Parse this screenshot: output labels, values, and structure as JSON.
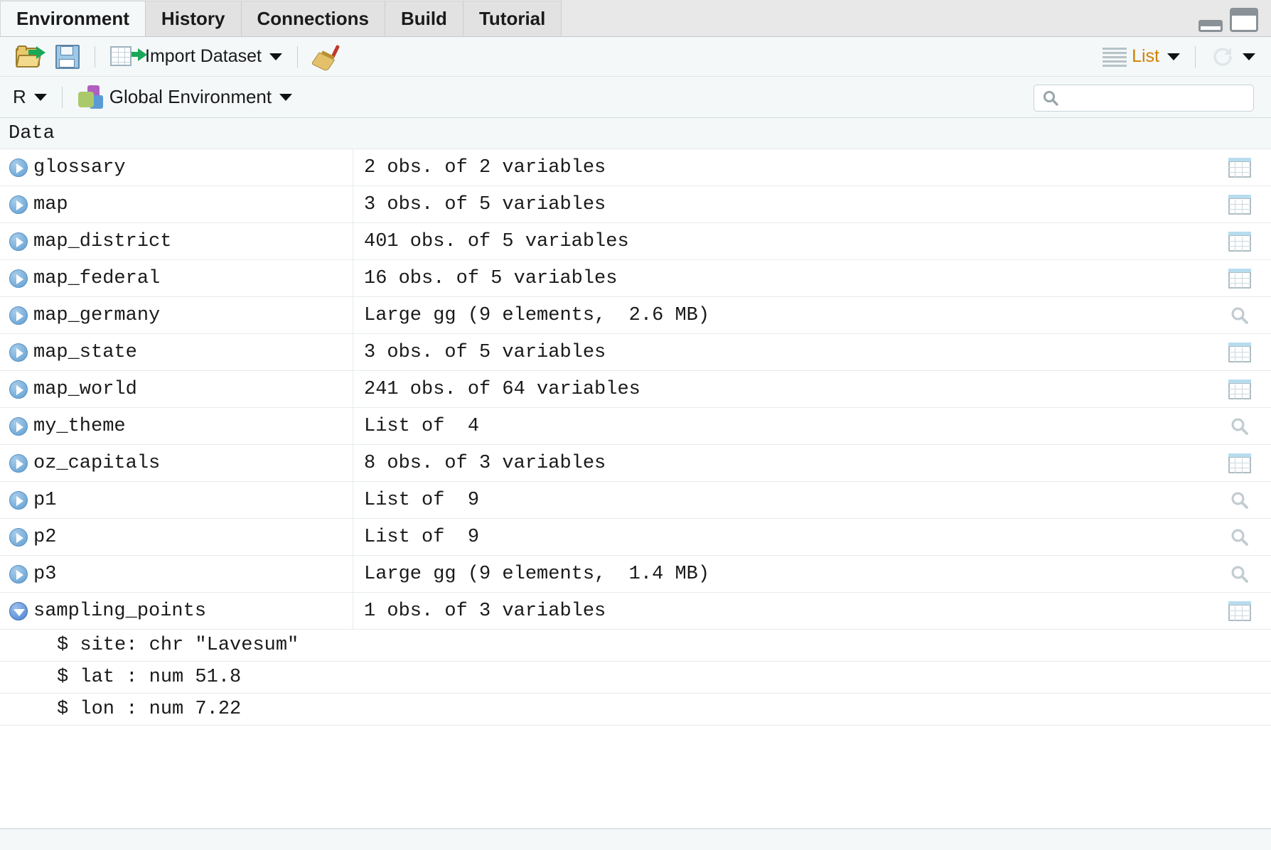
{
  "window": {
    "tabs": [
      {
        "label": "Environment",
        "active": true
      },
      {
        "label": "History",
        "active": false
      },
      {
        "label": "Connections",
        "active": false
      },
      {
        "label": "Build",
        "active": false
      },
      {
        "label": "Tutorial",
        "active": false
      }
    ],
    "minimize_icon": "minimize-icon",
    "maximize_icon": "maximize-icon"
  },
  "toolbar": {
    "load_workspace_icon": "open-folder-icon",
    "save_workspace_icon": "save-disk-icon",
    "import_dataset_label": "Import Dataset",
    "import_dataset_icon": "import-grid-icon",
    "clear_objects_icon": "broom-icon",
    "view_mode_label": "List",
    "view_mode_icon": "list-view-icon",
    "refresh_icon": "refresh-icon"
  },
  "envbar": {
    "language_label": "R",
    "environment_label": "Global Environment",
    "environment_icon": "cubes-icon",
    "search_placeholder": "",
    "search_value": "",
    "search_icon": "search-icon"
  },
  "table": {
    "group_header": "Data",
    "rows": [
      {
        "name": "glossary",
        "value": "2 obs. of 2 variables",
        "action": "view-grid-icon",
        "expanded": false
      },
      {
        "name": "map",
        "value": "3 obs. of 5 variables",
        "action": "view-grid-icon",
        "expanded": false
      },
      {
        "name": "map_district",
        "value": "401 obs. of 5 variables",
        "action": "view-grid-icon",
        "expanded": false
      },
      {
        "name": "map_federal",
        "value": "16 obs. of 5 variables",
        "action": "view-grid-icon",
        "expanded": false
      },
      {
        "name": "map_germany",
        "value": "Large gg (9 elements,  2.6 MB)",
        "action": "magnifier-icon",
        "expanded": false
      },
      {
        "name": "map_state",
        "value": "3 obs. of 5 variables",
        "action": "view-grid-icon",
        "expanded": false
      },
      {
        "name": "map_world",
        "value": "241 obs. of 64 variables",
        "action": "view-grid-icon",
        "expanded": false
      },
      {
        "name": "my_theme",
        "value": "List of  4",
        "action": "magnifier-icon",
        "expanded": false
      },
      {
        "name": "oz_capitals",
        "value": "8 obs. of 3 variables",
        "action": "view-grid-icon",
        "expanded": false
      },
      {
        "name": "p1",
        "value": "List of  9",
        "action": "magnifier-icon",
        "expanded": false
      },
      {
        "name": "p2",
        "value": "List of  9",
        "action": "magnifier-icon",
        "expanded": false
      },
      {
        "name": "p3",
        "value": "Large gg (9 elements,  1.4 MB)",
        "action": "magnifier-icon",
        "expanded": false
      },
      {
        "name": "sampling_points",
        "value": "1 obs. of 3 variables",
        "action": "view-grid-icon",
        "expanded": true
      }
    ],
    "subrows": [
      {
        "text": "$ site: chr \"Lavesum\""
      },
      {
        "text": "$ lat : num 51.8"
      },
      {
        "text": "$ lon : num 7.22"
      }
    ]
  },
  "colors": {
    "tab_active_bg": "#f4f8f9",
    "tab_inactive_bg": "#e2e2e2",
    "toolbar_bg": "#f4f8f9",
    "body_bg": "#ffffff",
    "row_border": "#e6ebed",
    "expander_blue": "#7fb3dd",
    "grid_header_blue": "#b7dcef",
    "folder_yellow": "#e8c86a",
    "arrow_green": "#1aa858"
  }
}
